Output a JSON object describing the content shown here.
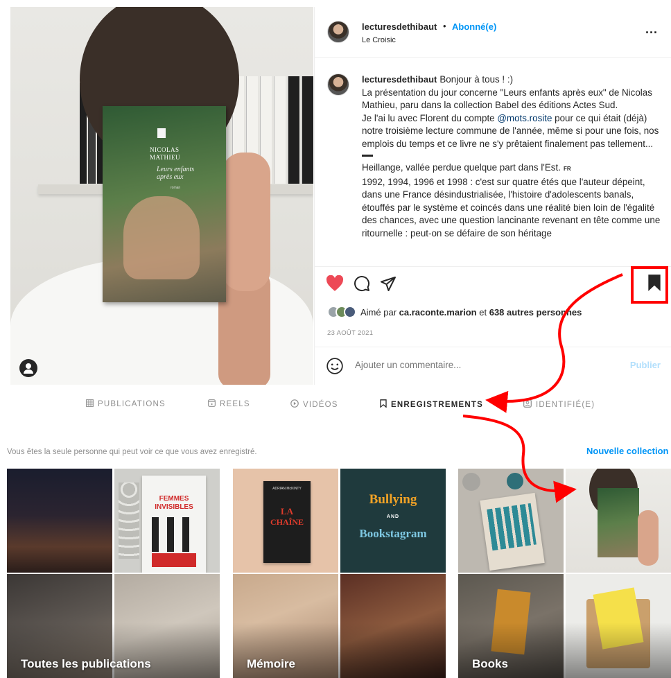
{
  "post": {
    "username": "lecturesdethibaut",
    "separator": "•",
    "follow_label": "Abonné(e)",
    "location": "Le Croisic",
    "more_label": "...",
    "book_cover": {
      "author": "NICOLAS\nMATHIEU",
      "title": "Leurs enfants\naprès eux",
      "genre": "roman"
    },
    "caption": {
      "username": "lecturesdethibaut",
      "line1": "Bonjour à tous ! :)",
      "line2": "La présentation du jour concerne \"Leurs enfants après eux\" de Nicolas Mathieu, paru dans la collection Babel des éditions Actes Sud.",
      "line3_start": "Je l'ai lu avec Florent du compte ",
      "mention": "@mots.rosite",
      "line3_end": " pour ce qui était (déjà) notre troisième lecture commune de l'année, même si pour une fois, nos emplois du temps et ce livre ne s'y prêtaient finalement pas tellement...",
      "line4": "Heillange, vallée perdue quelque part dans l'Est.",
      "flag": "FR",
      "line5": "1992, 1994, 1996 et 1998 : c'est sur quatre étés que l'auteur dépeint, dans une France désindustrialisée, l'histoire d'adolescents banals, étouffés par le système et coincés dans une réalité bien loin de l'égalité des chances, avec une question lancinante revenant en tête comme une ritournelle : peut-on se défaire de son héritage"
    },
    "likes": {
      "prefix": "Aimé par ",
      "first_liker": "ca.raconte.marion",
      "middle": " et ",
      "others": "638 autres personnes"
    },
    "date": "23 AOÛT 2021",
    "comment_placeholder": "Ajouter un commentaire...",
    "publish_label": "Publier"
  },
  "profile": {
    "tabs": [
      {
        "label": "PUBLICATIONS",
        "icon": "grid-icon"
      },
      {
        "label": "REELS",
        "icon": "reels-icon"
      },
      {
        "label": "VIDÉOS",
        "icon": "play-circle-icon"
      },
      {
        "label": "ENREGISTREMENTS",
        "icon": "bookmark-icon"
      },
      {
        "label": "IDENTIFIÉ(E)",
        "icon": "tagged-user-icon"
      }
    ],
    "saved_note": "Vous êtes la seule personne qui peut voir ce que vous avez enregistré.",
    "new_collection_label": "Nouvelle collection",
    "collections": [
      {
        "name": "Toutes les publications",
        "cover_texts": [
          "FEMMES",
          "INVISIBLES"
        ]
      },
      {
        "name": "Mémoire",
        "cover_texts": [
          "LA",
          "CHAÎNE",
          "Bullying",
          "AND",
          "Bookstagram",
          "ADRIAN McKINTY"
        ]
      },
      {
        "name": "Books",
        "cover_texts": []
      }
    ]
  },
  "colors": {
    "accent_blue": "#0095f6",
    "like_red": "#ed4956",
    "highlight_red": "#ff0000"
  }
}
